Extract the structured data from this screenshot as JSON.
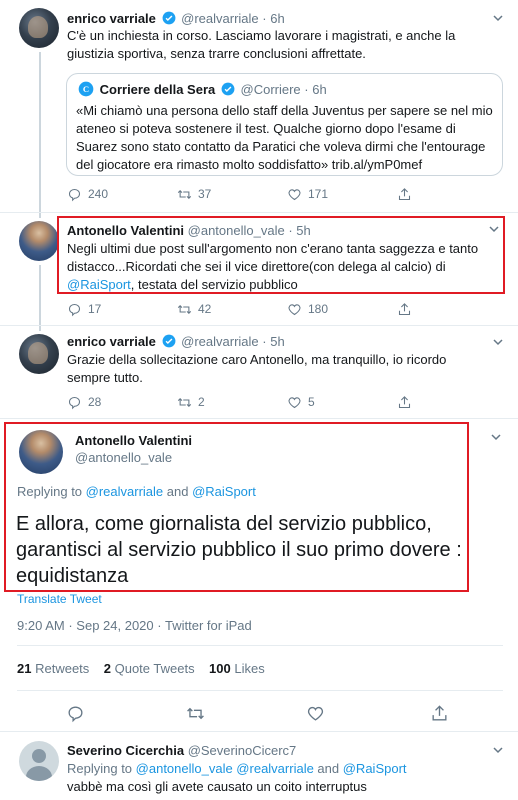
{
  "tweet1": {
    "name": "enrico varriale",
    "handle": "@realvarriale",
    "time": "6h",
    "text": "C'è  un inchiesta in corso. Lasciamo lavorare i magistrati, e anche la giustizia sportiva, senza trarre conclusioni affrettate.",
    "quote": {
      "name": "Corriere della Sera",
      "handle": "@Corriere",
      "time": "6h",
      "text": "«Mi chiamò una persona dello staff della Juventus per sapere se nel mio ateneo si poteva sostenere il test. Qualche giorno dopo l'esame di Suarez sono stato contatto da Paratici che voleva dirmi che l'entourage del giocatore era rimasto molto soddisfatto» trib.al/ymP0mef"
    },
    "replies": "240",
    "retweets": "37",
    "likes": "171"
  },
  "tweet2": {
    "name": "Antonello Valentini",
    "handle": "@antonello_vale",
    "time": "5h",
    "text_before": "Negli ultimi due post sull'argomento non c'erano tanta saggezza e tanto distacco...Ricordati che sei il vice direttore(con delega al calcio) di ",
    "mention": "@RaiSport",
    "text_after": ", testata del servizio pubblico",
    "replies": "17",
    "retweets": "42",
    "likes": "180"
  },
  "tweet3": {
    "name": "enrico varriale",
    "handle": "@realvarriale",
    "time": "5h",
    "text": "Grazie della sollecitazione caro Antonello, ma tranquillo, io ricordo sempre tutto.",
    "replies": "28",
    "retweets": "2",
    "likes": "5"
  },
  "main": {
    "name": "Antonello Valentini",
    "handle": "@antonello_vale",
    "replying_prefix": "Replying to ",
    "replying_to_1": "@realvarriale",
    "replying_and": " and ",
    "replying_to_2": "@RaiSport",
    "text": "E allora, come giornalista del servizio pubblico, garantisci al servizio pubblico il suo primo dovere : equidistanza",
    "translate": "Translate Tweet",
    "time": "9:20 AM",
    "date": "Sep 24, 2020",
    "dot": "·",
    "source": "Twitter for iPad",
    "retweets_count": "21",
    "retweets_label": "Retweets",
    "quotes_count": "2",
    "quotes_label": "Quote Tweets",
    "likes_count": "100",
    "likes_label": "Likes"
  },
  "reply": {
    "name": "Severino Cicerchia",
    "handle": "@SeverinoCicerc7",
    "time": "",
    "replying_prefix": "Replying to ",
    "mentions": "@antonello_vale @realvarriale",
    "and": " and ",
    "mention2": "@RaiSport",
    "text": "vabbè ma così gli avete causato un coito interruptus"
  },
  "colors": {
    "accent": "#1b95e0",
    "highlight_border": "#e01b24",
    "muted": "#657786"
  }
}
